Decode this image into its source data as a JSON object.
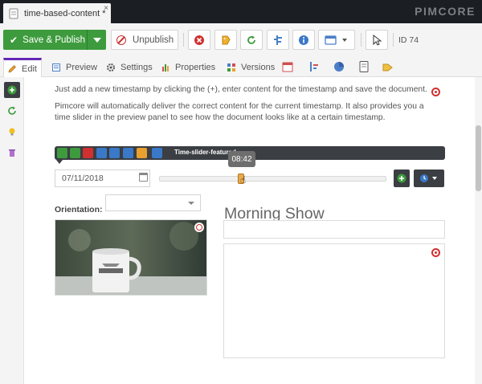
{
  "tab": {
    "title": "time-based-content *",
    "close": "×"
  },
  "brand": "PIMCORE",
  "toolbar": {
    "save_publish": "Save & Publish",
    "unpublish": "Unpublish",
    "doc_id": "ID 74"
  },
  "subtabs": {
    "edit": "Edit",
    "preview": "Preview",
    "settings": "Settings",
    "properties": "Properties",
    "versions": "Versions"
  },
  "content": {
    "para1": "Just add a new timestamp by clicking the (+), enter content for the timestamp and save the document.",
    "para2": "Pimcore will automatically deliver the correct content for the current timestamp. It also provides you a time slider in the preview panel to see how the document looks like at a certain timestamp.",
    "editable_label": "Time-slider-featured",
    "time_bubble": "08:42",
    "date": "07/11/2018",
    "orientation_label": "Orientation:",
    "heading": "Morning Show",
    "slider_position": 0.36
  },
  "colors": {
    "accent": "#6428b4",
    "save_green": "#3d9b3d",
    "dark": "#3b3e43",
    "danger": "#d03030"
  }
}
